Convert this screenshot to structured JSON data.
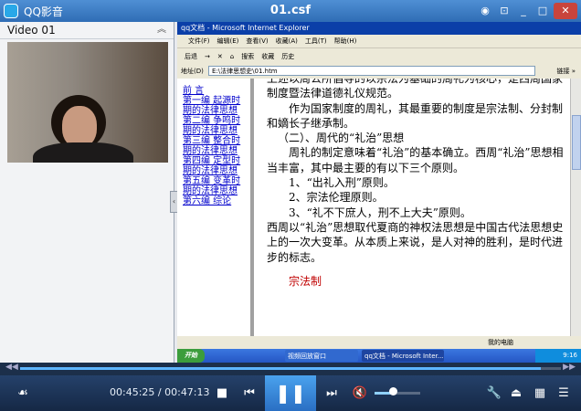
{
  "titlebar": {
    "app_name": "QQ影音",
    "file_name": "01.csf",
    "buttons": [
      "◉",
      "⊡",
      "_",
      "□",
      "✕"
    ]
  },
  "left_panel": {
    "title": "Video 01",
    "collapse_icon": "chevron-up-icon"
  },
  "ie": {
    "title": "qq文档 - Microsoft Internet Explorer",
    "menu": [
      "文件(F)",
      "编辑(E)",
      "查看(V)",
      "收藏(A)",
      "工具(T)",
      "帮助(H)"
    ],
    "toolbar": [
      "后退",
      "→",
      "✕",
      "⌂",
      "搜索",
      "收藏",
      "历史"
    ],
    "address_label": "地址(D)",
    "address_value": "E:\\法律思想史\\01.htm",
    "go_label": "转到",
    "links_label": "链接 »",
    "status_text": "我的电脑",
    "toc": [
      "前 言",
      "第一编 起源时期的法律思想",
      "第二编 争鸣时期的法律思想",
      "第三编 整合时期的法律思想",
      "第四编 定型时期的法律思想",
      "第五编 变革时期的法律思想",
      "第六编 综论"
    ],
    "content": [
      "上述以周公所倡导的以宗法为基础的周礼为核心，是西周国家制度暨法律道德礼仪规范。",
      "作为国家制度的周礼，其最重要的制度是宗法制、分封制和嫡长子继承制。",
      "（二）、周代的“礼治”思想",
      "周礼的制定意味着“礼治”的基本确立。西周“礼治”思想相当丰富，其中最主要的有以下三个原则。",
      "1、“出礼入刑”原则。",
      "2、宗法伦理原则。",
      "3、“礼不下庶人，刑不上大夫”原则。",
      "西周以“礼治”思想取代夏商的神权法思想是中国古代法思想史上的一次大变革。从本质上来说，是人对神的胜利，是时代进步的标志。"
    ],
    "section_title": "宗法制"
  },
  "taskbar": {
    "start": "开始",
    "task1": "视频回放窗口",
    "task2": "qq文档 - Microsoft Inter...",
    "clock": "9:16"
  },
  "player": {
    "elapsed": "00:45:25",
    "total": "00:47:13",
    "time_sep": " / ",
    "progress": 0.962,
    "volume": 0.4,
    "progress_left": "◀◀",
    "progress_right": "▶▶"
  },
  "icons": {
    "footprint": "footprint-icon",
    "stop": "stop-icon",
    "prev": "prev-icon",
    "pause": "pause-icon",
    "next": "next-icon",
    "volume": "volume-muted-icon",
    "settings": "wrench-icon",
    "eject": "eject-icon",
    "equalizer": "equalizer-icon",
    "playlist": "playlist-icon"
  },
  "colors": {
    "accent": "#2f6db5",
    "play_button": "#3b8be0",
    "progress": "#5db5ff"
  }
}
